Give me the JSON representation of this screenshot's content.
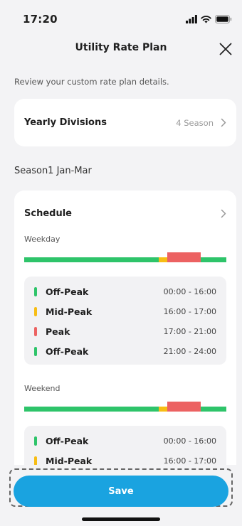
{
  "status": {
    "time": "17:20"
  },
  "nav": {
    "title": "Utility Rate Plan"
  },
  "subtitle": "Review your custom rate plan details.",
  "yearly": {
    "label": "Yearly Divisions",
    "value": "4 Season"
  },
  "season": {
    "title": "Season1 Jan-Mar"
  },
  "schedule": {
    "label": "Schedule",
    "weekday": {
      "label": "Weekday",
      "periods": [
        {
          "name": "Off-Peak",
          "time": "00:00 - 16:00",
          "color": "#2ec46a"
        },
        {
          "name": "Mid-Peak",
          "time": "16:00 - 17:00",
          "color": "#f7bd14"
        },
        {
          "name": "Peak",
          "time": "17:00 - 21:00",
          "color": "#ec6262"
        },
        {
          "name": "Off-Peak",
          "time": "21:00 - 24:00",
          "color": "#2ec46a"
        }
      ]
    },
    "weekend": {
      "label": "Weekend",
      "periods": [
        {
          "name": "Off-Peak",
          "time": "00:00 - 16:00",
          "color": "#2ec46a"
        },
        {
          "name": "Mid-Peak",
          "time": "16:00 - 17:00",
          "color": "#f7bd14"
        }
      ]
    }
  },
  "footer": {
    "save_label": "Save"
  },
  "colors": {
    "accent": "#1aa3e0",
    "off_peak": "#2ec46a",
    "mid_peak": "#f7bd14",
    "peak": "#ec6262"
  }
}
